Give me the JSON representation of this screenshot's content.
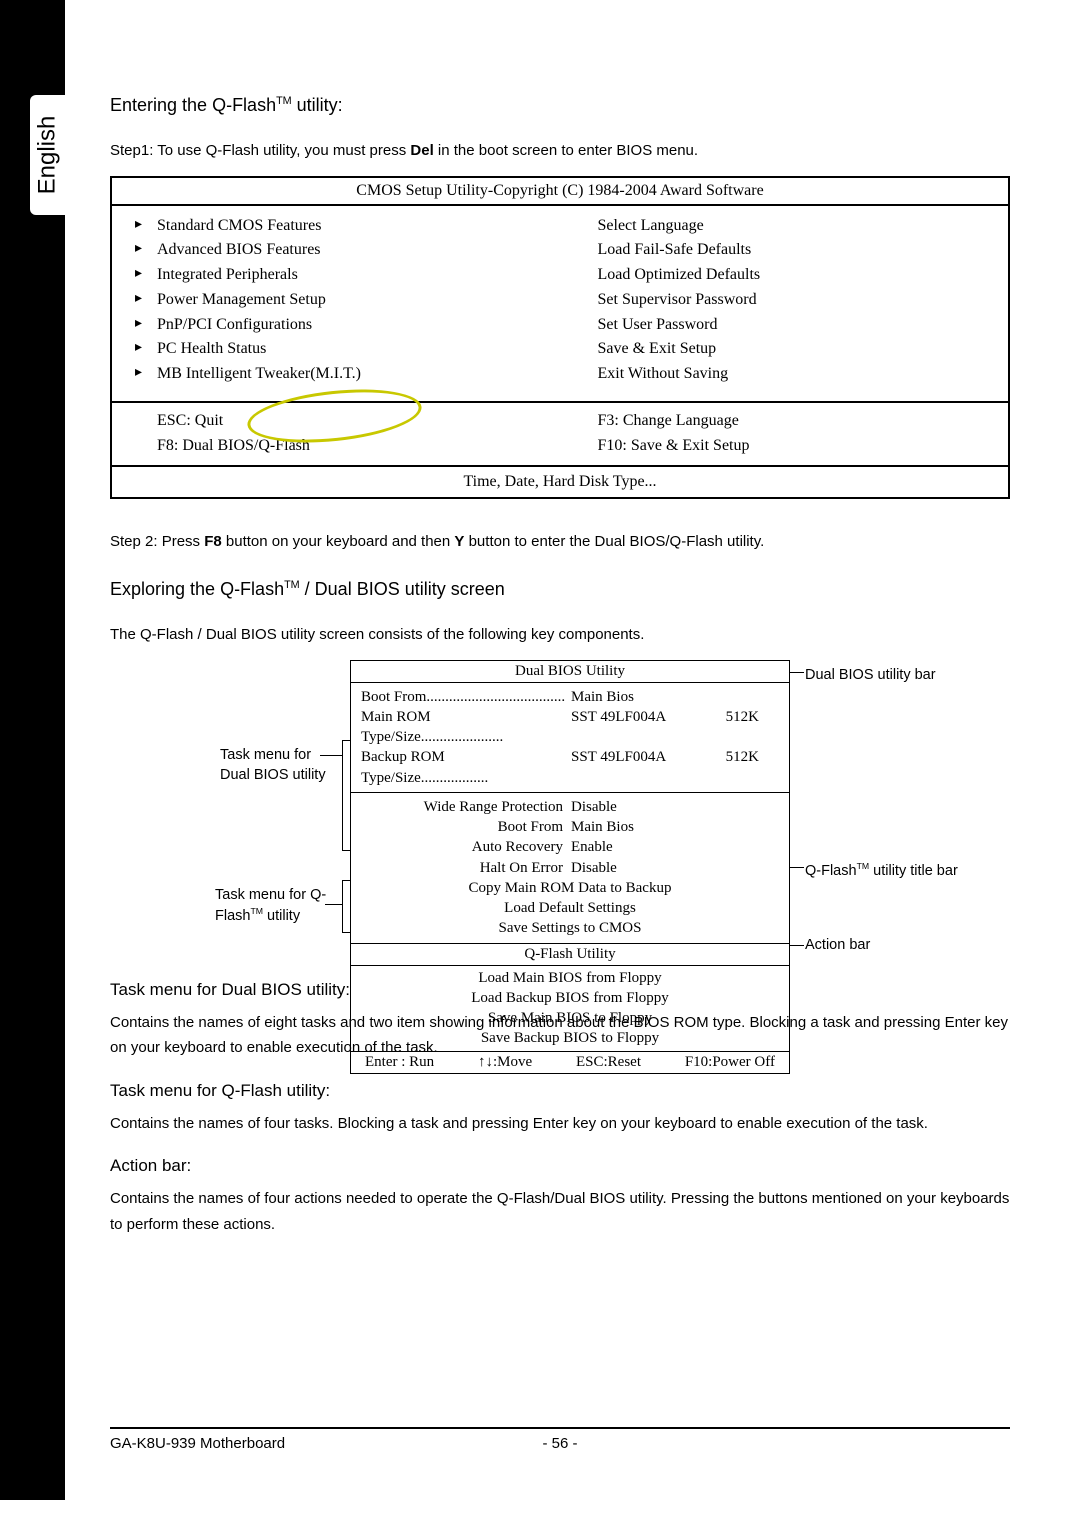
{
  "language_tab": "English",
  "section1": {
    "title_prefix": "Entering the Q-Flash",
    "title_suffix": " utility:",
    "step1_pre": "Step1: To use Q-Flash utility, you must press ",
    "step1_key": "Del",
    "step1_post": " in the boot screen to enter BIOS menu."
  },
  "bios_box": {
    "title": "CMOS Setup Utility-Copyright (C) 1984-2004 Award Software",
    "left_items": [
      "Standard CMOS Features",
      "Advanced BIOS Features",
      "Integrated Peripherals",
      "Power Management Setup",
      "PnP/PCI Configurations",
      "PC Health Status",
      "MB Intelligent Tweaker(M.I.T.)"
    ],
    "right_items": [
      "Select Language",
      "Load Fail-Safe Defaults",
      "Load Optimized Defaults",
      "Set Supervisor Password",
      "Set User Password",
      "Save & Exit Setup",
      "Exit Without Saving"
    ],
    "footer_left": [
      "ESC: Quit",
      "F8: Dual BIOS/Q-Flash"
    ],
    "footer_right": [
      "F3: Change Language",
      "F10: Save & Exit Setup"
    ],
    "bottom": "Time, Date, Hard Disk Type..."
  },
  "step2_pre": "Step 2: Press ",
  "step2_k1": "F8",
  "step2_mid": " button on your keyboard and then ",
  "step2_k2": "Y",
  "step2_post": " button to enter the Dual BIOS/Q-Flash utility.",
  "section2": {
    "title_prefix": "Exploring the Q-Flash",
    "title_suffix": " / Dual BIOS utility screen",
    "para": "The Q-Flash / Dual BIOS utility screen consists of the following key components."
  },
  "diagram": {
    "title1": "Dual BIOS Utility",
    "info_rows": [
      {
        "lbl": "Boot From.....................................",
        "val": "Main Bios",
        "sz": ""
      },
      {
        "lbl": "Main ROM Type/Size......................",
        "val": "SST 49LF004A",
        "sz": "512K"
      },
      {
        "lbl": "Backup ROM Type/Size..................",
        "val": "SST 49LF004A",
        "sz": "512K"
      }
    ],
    "task_rows": [
      {
        "lbl": "Wide Range Protection",
        "val": "Disable"
      },
      {
        "lbl": "Boot From",
        "val": "Main Bios"
      },
      {
        "lbl": "Auto Recovery",
        "val": "Enable"
      },
      {
        "lbl": "Halt On Error",
        "val": "Disable"
      }
    ],
    "task_center": [
      "Copy Main ROM Data to Backup",
      "Load Default Settings",
      "Save Settings to CMOS"
    ],
    "title2": "Q-Flash Utility",
    "qflash_tasks": [
      "Load Main BIOS from Floppy",
      "Load Backup BIOS from Floppy",
      "Save Main BIOS to Floppy",
      "Save Backup BIOS to Floppy"
    ],
    "actions": [
      "Enter : Run",
      "↑↓:Move",
      "ESC:Reset",
      "F10:Power Off"
    ],
    "callouts": {
      "left1": "Task menu for Dual BIOS utility",
      "left2_pre": "Task menu for Q-Flash",
      "left2_suf": " utility",
      "right1": "Dual BIOS utility bar",
      "right2_pre": "Q-Flash",
      "right2_suf": " utility title bar",
      "right3": "Action bar"
    }
  },
  "section3": {
    "h1": "Task menu for Dual BIOS utility:",
    "p1": "Contains the names of eight tasks and two item showing information about the BIOS ROM type. Blocking a task and pressing Enter key on your keyboard to enable execution of the task.",
    "h2": "Task menu for Q-Flash utility:",
    "p2": "Contains the names of four tasks. Blocking a task and pressing Enter key on your keyboard to enable execution of the task.",
    "h3": "Action bar:",
    "p3": "Contains the names of four actions needed to operate the Q-Flash/Dual BIOS utility. Pressing the buttons mentioned on your keyboards to perform these actions."
  },
  "footer": {
    "left": "GA-K8U-939 Motherboard",
    "page": "- 56 -"
  }
}
